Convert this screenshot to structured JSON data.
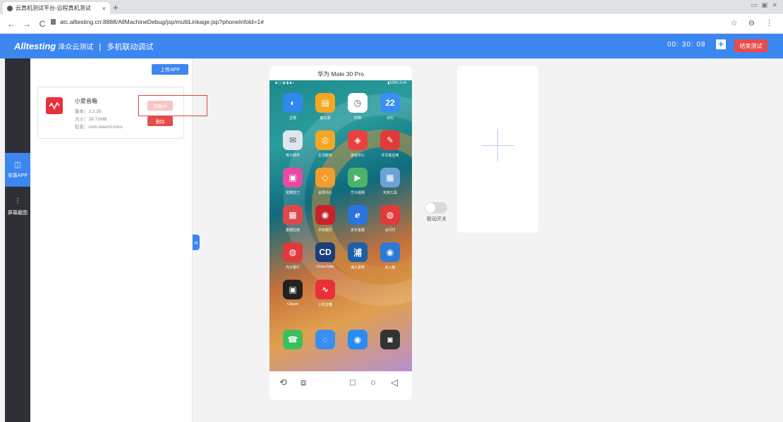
{
  "browser": {
    "tab_title": "云真机测试平台-远程真机测试",
    "tab_close": "×",
    "new_tab": "+",
    "url": "atc.alltesting.cn:8888/AllMachineDebug/jsp/multiLinkage.jsp?phoneInfold=1#",
    "window_controls": "▭ ▣ ✕",
    "nav_back": "←",
    "nav_forward": "→",
    "nav_reload": "C",
    "right_icons": "☆ ⊖ ⋮"
  },
  "header": {
    "logo": "Alltesting",
    "logo_cn": "泽众云测试",
    "separator": "|",
    "title": "多机联动调试",
    "timer": "00:  30:  08",
    "add_label": "+",
    "end_button": "结束测试"
  },
  "sidebar": {
    "items": [
      {
        "label": "安装APP",
        "icon": "◫"
      },
      {
        "label": "屏幕截图",
        "icon": "⫶"
      }
    ]
  },
  "panel": {
    "upload_button": "上传APP",
    "app": {
      "name": "小爱音箱",
      "version": "版本：2.2.35",
      "size": "大小：39.71MB",
      "package": "包名：com.xiaomi.mico",
      "installing_button": "卸载中",
      "delete_button": "删除"
    },
    "collapse_icon": "«"
  },
  "phone": {
    "name": "华为 Mate 30 Pro",
    "status_left": "■ ▢ ◉ ▮ ■ ▪",
    "status_right": "▮100% 3:44",
    "apps": [
      {
        "label": "主题",
        "color": "#2f88ef",
        "glyph": "◐"
      },
      {
        "label": "备忘录",
        "color": "#f5a623",
        "glyph": "▤"
      },
      {
        "label": "时钟",
        "color": "#ffffff",
        "glyph": "◷"
      },
      {
        "label": "日历",
        "color": "#3a8ff3",
        "glyph": "22"
      },
      {
        "label": "电子邮件",
        "color": "#dfe6ee",
        "glyph": "✉"
      },
      {
        "label": "生活服务",
        "color": "#f5a623",
        "glyph": "◎"
      },
      {
        "label": "游戏中心",
        "color": "#e9413f",
        "glyph": "◈"
      },
      {
        "label": "手写笔应用",
        "color": "#e03b3b",
        "glyph": "✎"
      },
      {
        "label": "花瓣剪刀",
        "color": "#e64aa3",
        "glyph": "▣"
      },
      {
        "label": "会员中心",
        "color": "#f39c2e",
        "glyph": "◇"
      },
      {
        "label": "华为视频",
        "color": "#4bb46a",
        "glyph": "▶"
      },
      {
        "label": "实用工具",
        "color": "#6ba3d6",
        "glyph": "▦"
      },
      {
        "label": "金融应用",
        "color": "#e04848",
        "glyph": "▩"
      },
      {
        "label": "中信银行",
        "color": "#c8232c",
        "glyph": "◉"
      },
      {
        "label": "京东金融",
        "color": "#2a74e0",
        "glyph": "ℯ"
      },
      {
        "label": "云闪付",
        "color": "#e03a3a",
        "glyph": "◍"
      },
      {
        "label": "光大银行",
        "color": "#e03a3a",
        "glyph": "◍"
      },
      {
        "label": "China Daily",
        "color": "#1a3e7a",
        "glyph": "CD"
      },
      {
        "label": "浦大喜奔",
        "color": "#1d5fa8",
        "glyph": "浦"
      },
      {
        "label": "买入客",
        "color": "#2d7ad6",
        "glyph": "◉"
      },
      {
        "label": "Clipper",
        "color": "#222222",
        "glyph": "▣"
      },
      {
        "label": "小爱音箱",
        "color": "#e9303a",
        "glyph": "∿"
      }
    ],
    "dock": [
      {
        "color": "#3cbf5e",
        "glyph": "☎"
      },
      {
        "color": "#3a8ff3",
        "glyph": "◌"
      },
      {
        "color": "#2d8bf0",
        "glyph": "◉"
      },
      {
        "color": "#333333",
        "glyph": "◙"
      }
    ],
    "nav": {
      "rotate": "⟲",
      "screenshot": "⧈",
      "recent": "□",
      "home": "○",
      "back": "◁"
    }
  },
  "sync": {
    "label": "联动开关"
  }
}
